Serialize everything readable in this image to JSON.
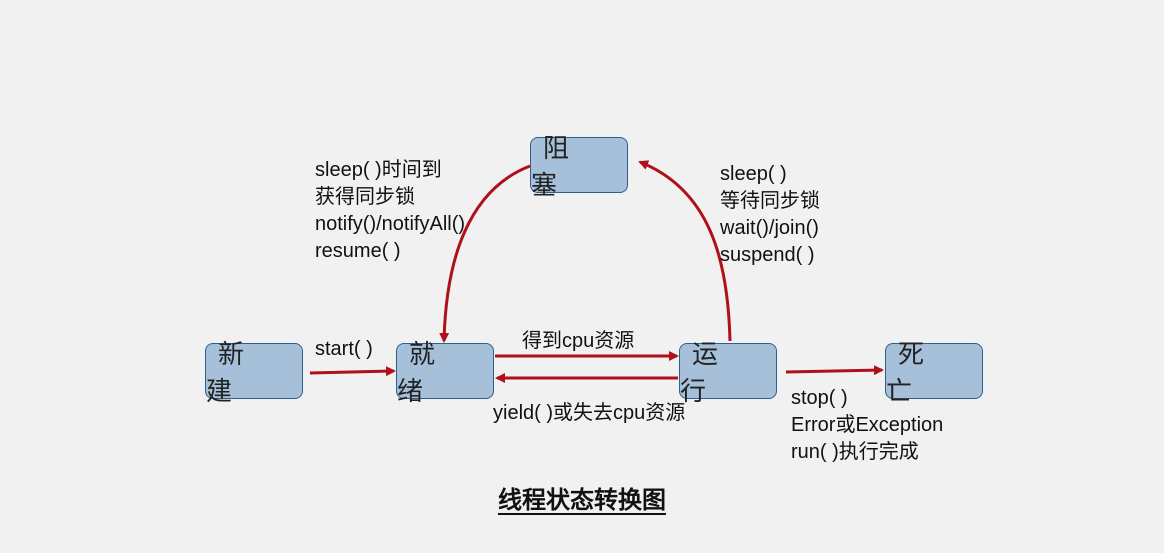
{
  "nodes": {
    "new": "新 建",
    "ready": "就 绪",
    "blocked": "阻 塞",
    "running": "运 行",
    "dead": "死 亡"
  },
  "edges": {
    "new_to_ready": [
      "start( )"
    ],
    "ready_to_running": [
      "得到cpu资源"
    ],
    "running_to_ready": [
      "yield( )或失去cpu资源"
    ],
    "running_to_blocked": [
      "sleep( )",
      "等待同步锁",
      "wait()/join()",
      "suspend( )"
    ],
    "blocked_to_ready": [
      "sleep( )时间到",
      "获得同步锁",
      "notify()/notifyAll()",
      "resume( )"
    ],
    "running_to_dead": [
      "stop( )",
      "Error或Exception",
      "run( )执行完成"
    ]
  },
  "title": "线程状态转换图",
  "colors": {
    "background": "#f1f1f1",
    "node_fill": "#a7c0da",
    "node_border": "#2f5f8f",
    "arrow": "#b0101a"
  }
}
